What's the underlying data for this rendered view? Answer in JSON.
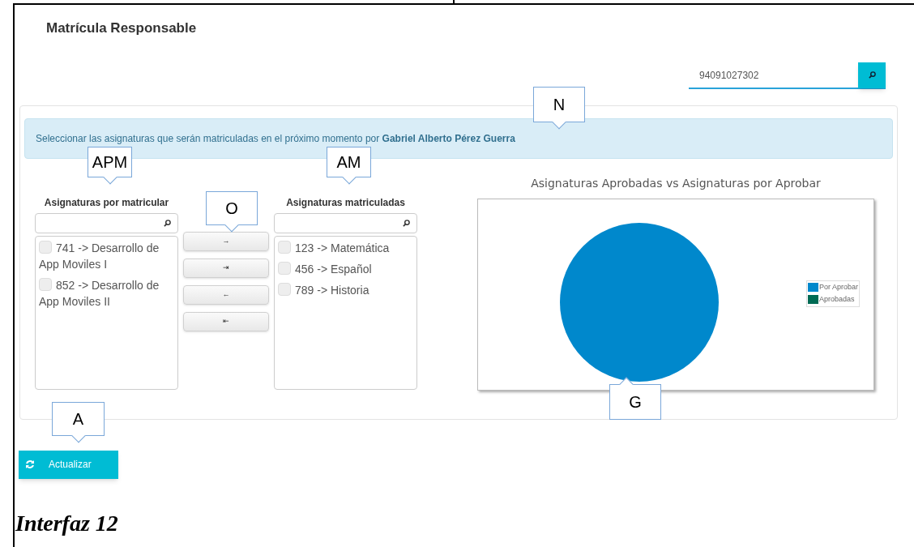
{
  "page_title": "Matrícula Responsable",
  "search": {
    "value": "94091027302"
  },
  "alert": {
    "text": "Seleccionar las asignaturas que serán matriculadas en el próximo momento por **Gabriel Alberto Pérez Guerra**"
  },
  "available": {
    "title": "Asignaturas por matricular",
    "items": [
      {
        "label": "741 -> Desarrollo de App Moviles I",
        "checked": false
      },
      {
        "label": "852 -> Desarrollo de App Moviles II",
        "checked": false
      }
    ]
  },
  "transfer_buttons": [
    "→",
    "⇥",
    "←",
    "⇤"
  ],
  "enrolled": {
    "title": "Asignaturas matriculadas",
    "items": [
      {
        "label": "123 -> Matemática",
        "checked": false
      },
      {
        "label": "456 -> Español",
        "checked": false
      },
      {
        "label": "789 -> Historia",
        "checked": false
      }
    ]
  },
  "chart": {
    "title": "Asignaturas Aprobadas vs Asignaturas por Aprobar",
    "legend": [
      {
        "label": "Por Aprobar",
        "color": "#0088cc"
      },
      {
        "label": "Aprobadas",
        "color": "#006b54"
      }
    ]
  },
  "refresh_button": "Actualizar",
  "callouts": [
    {
      "text": "N",
      "kind": "down"
    },
    {
      "text": "APM",
      "kind": "down"
    },
    {
      "text": "AM",
      "kind": "down"
    },
    {
      "text": "O",
      "kind": "down"
    },
    {
      "text": "G",
      "kind": "up"
    },
    {
      "text": "A",
      "kind": "down"
    }
  ],
  "caption": "Interfaz 12"
}
